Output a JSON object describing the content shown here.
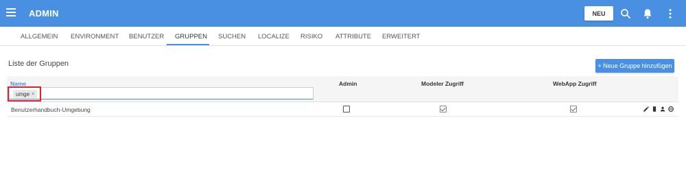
{
  "header": {
    "title": "ADMIN",
    "new_label": "NEU",
    "accent_color": "#4a90e2",
    "icons": [
      "menu-icon",
      "search-icon",
      "bell-icon",
      "more-vert-icon"
    ]
  },
  "tabs": [
    {
      "label": "ALLGEMEIN",
      "active": false
    },
    {
      "label": "ENVIRONMENT",
      "active": false
    },
    {
      "label": "BENUTZER",
      "active": false
    },
    {
      "label": "GRUPPEN",
      "active": true
    },
    {
      "label": "SUCHEN",
      "active": false
    },
    {
      "label": "LOCALIZE",
      "active": false
    },
    {
      "label": "RISIKO",
      "active": false
    },
    {
      "label": "ATTRIBUTE",
      "active": false
    },
    {
      "label": "ERWEITERT",
      "active": false
    }
  ],
  "main": {
    "section_title": "Liste der Gruppen",
    "add_button": "+ Neue Gruppe hinzufügen",
    "table": {
      "columns": [
        "Name",
        "Admin",
        "Modeler Zugriff",
        "WebApp Zugriff"
      ],
      "filter_chip": "umge",
      "filter_chip_remove": "×",
      "rows": [
        {
          "name": "Benutzerhandbuch-Umgebung",
          "admin": false,
          "modeler": true,
          "webapp": true,
          "actions": [
            "edit-icon",
            "delete-icon",
            "person-icon",
            "globe-icon"
          ]
        }
      ]
    }
  },
  "highlight_color": "#e0222c"
}
